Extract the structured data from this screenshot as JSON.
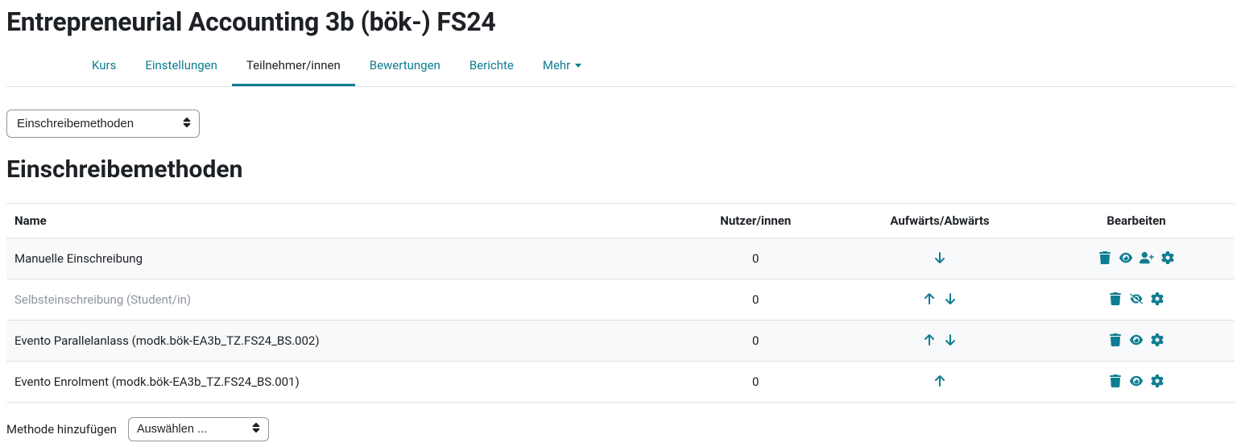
{
  "page": {
    "title": "Entrepreneurial Accounting 3b (bök-) FS24",
    "section_title": "Einschreibemethoden"
  },
  "tabs": {
    "items": [
      {
        "label": "Kurs",
        "active": false
      },
      {
        "label": "Einstellungen",
        "active": false
      },
      {
        "label": "Teilnehmer/innen",
        "active": true
      },
      {
        "label": "Bewertungen",
        "active": false
      },
      {
        "label": "Berichte",
        "active": false
      }
    ],
    "more_label": "Mehr"
  },
  "dropdown": {
    "selected": "Einschreibemethoden"
  },
  "table": {
    "headers": {
      "name": "Name",
      "users": "Nutzer/innen",
      "updown": "Aufwärts/Abwärts",
      "edit": "Bearbeiten"
    },
    "rows": [
      {
        "name": "Manuelle Einschreibung",
        "users": "0",
        "dimmed": false,
        "up": false,
        "down": true,
        "actions": [
          "delete",
          "show",
          "enrol-users",
          "settings"
        ]
      },
      {
        "name": "Selbsteinschreibung (Student/in)",
        "users": "0",
        "dimmed": true,
        "up": true,
        "down": true,
        "actions": [
          "delete",
          "hidden",
          "settings"
        ]
      },
      {
        "name": "Evento Parallelanlass (modk.bök-EA3b_TZ.FS24_BS.002)",
        "users": "0",
        "dimmed": false,
        "up": true,
        "down": true,
        "actions": [
          "delete",
          "show",
          "settings"
        ]
      },
      {
        "name": "Evento Enrolment (modk.bök-EA3b_TZ.FS24_BS.001)",
        "users": "0",
        "dimmed": false,
        "up": true,
        "down": false,
        "actions": [
          "delete",
          "show",
          "settings"
        ]
      }
    ]
  },
  "add_method": {
    "label": "Methode hinzufügen",
    "placeholder": "Auswählen ..."
  }
}
